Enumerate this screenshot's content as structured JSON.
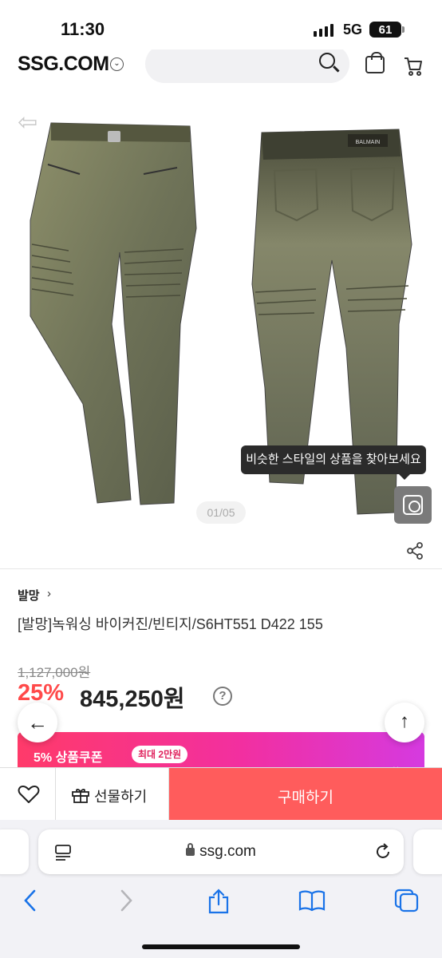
{
  "status_bar": {
    "time": "11:30",
    "network": "5G",
    "battery": "61"
  },
  "header": {
    "logo": "SSG.COM"
  },
  "gallery": {
    "tooltip": "비슷한 스타일의 상품을 찾아보세요",
    "pager": "01/05"
  },
  "product": {
    "brand": "발망",
    "title": "[발망]녹워싱 바이커진/빈티지/S6HT551 D422 155",
    "original_price": "1,127,000원",
    "discount": "25%",
    "price": "845,250원"
  },
  "coupon": {
    "label": "5% 상품쿠폰",
    "badge": "최대 2만원"
  },
  "actions": {
    "gift_label": "선물하기",
    "buy_label": "구매하기"
  },
  "browser": {
    "url": "ssg.com"
  },
  "colors": {
    "discount": "#ff4a4a",
    "buy_button": "#ff5c5c",
    "coupon_start": "#ff3a6a",
    "coupon_end": "#d53ae0"
  }
}
